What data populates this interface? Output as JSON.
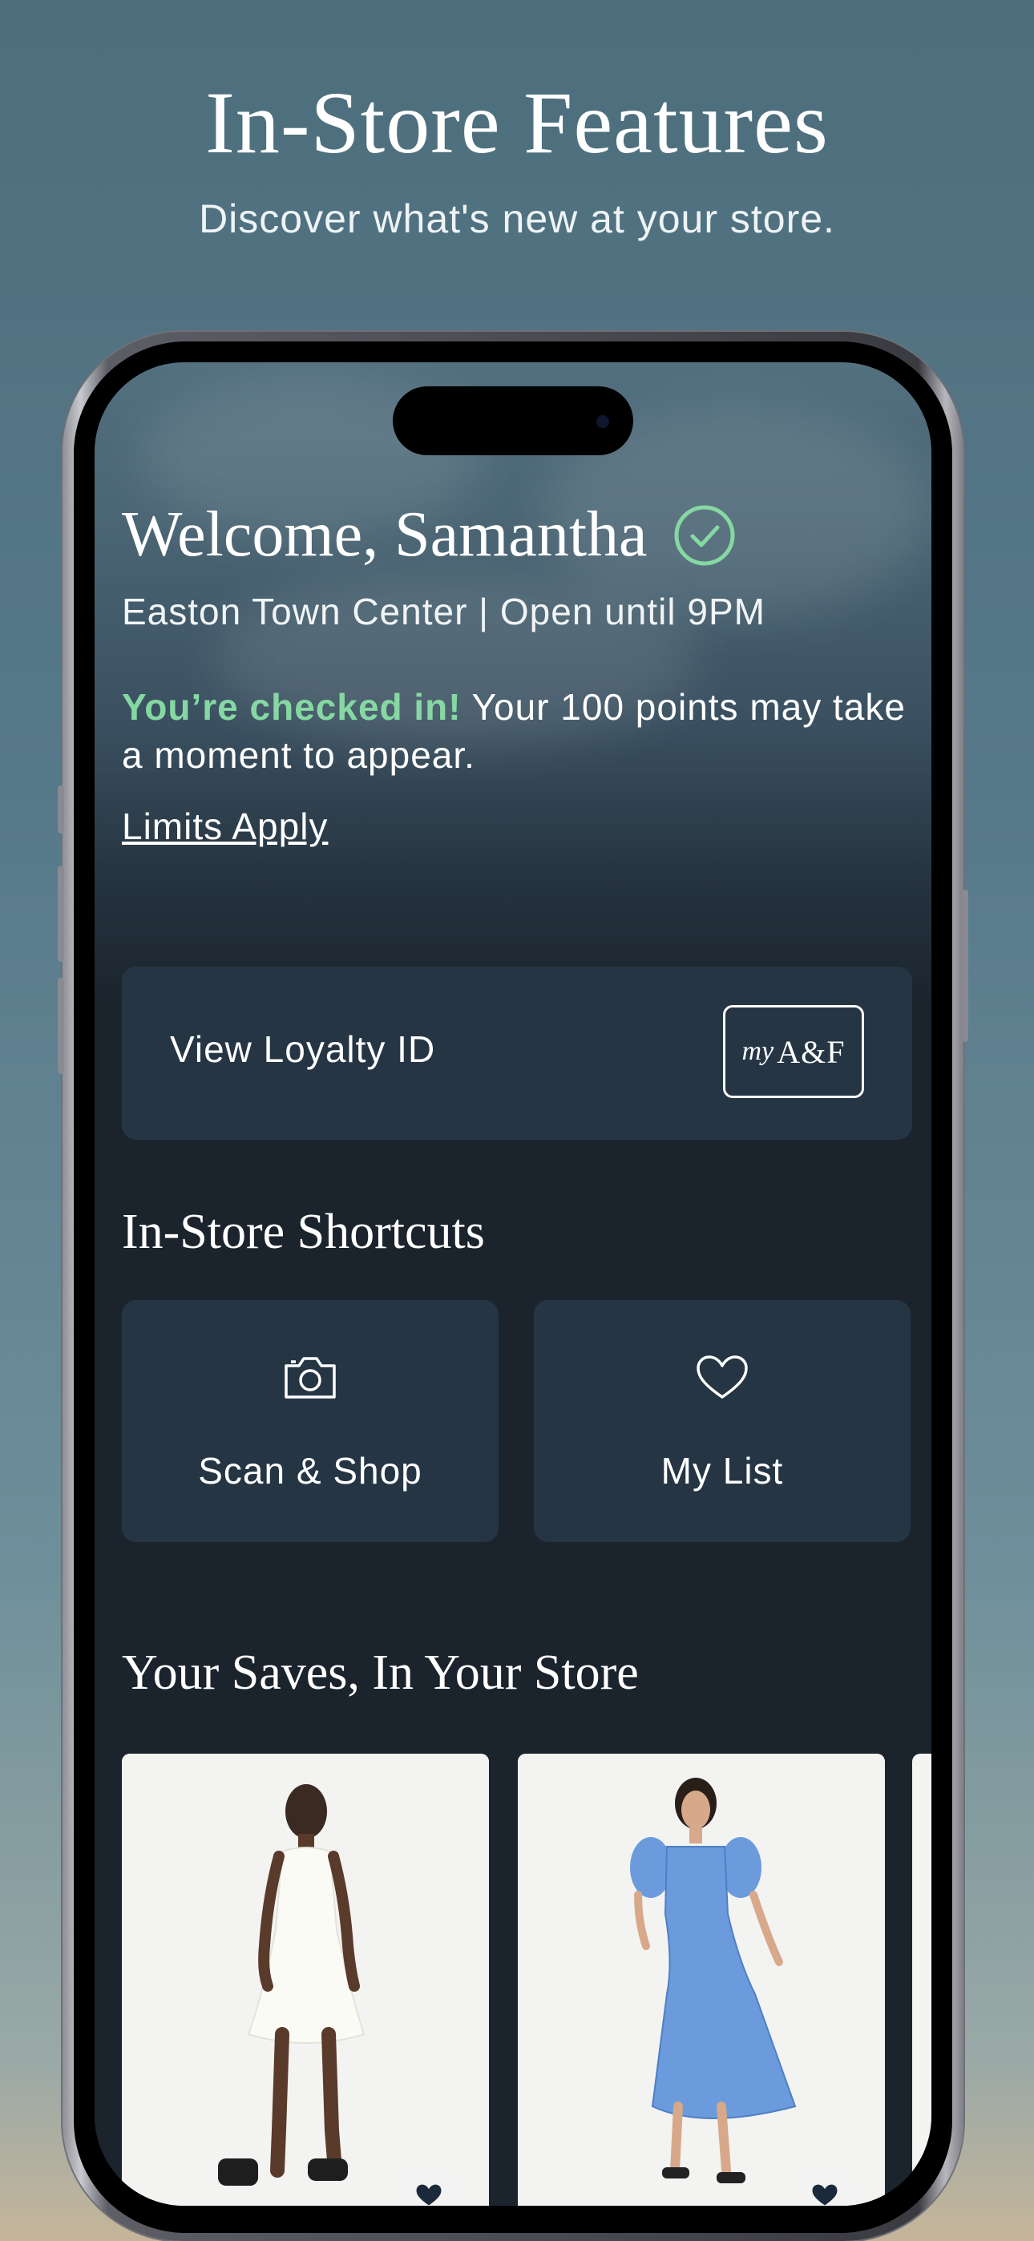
{
  "hero": {
    "title": "In-Store Features",
    "subtitle": "Discover what's new at your store."
  },
  "welcome": {
    "greeting": "Welcome, Samantha",
    "store_line": "Easton Town Center | Open until 9PM",
    "checked_in_bold": "You’re checked in!",
    "checked_in_rest": " Your 100 points may take a moment to appear.",
    "limits_link": "Limits Apply"
  },
  "loyalty": {
    "label": "View Loyalty ID",
    "logo_my": "my",
    "logo_af": "A&F"
  },
  "shortcuts": {
    "title": "In-Store Shortcuts",
    "items": [
      {
        "label": "Scan & Shop",
        "icon": "camera-icon"
      },
      {
        "label": "My List",
        "icon": "heart-outline-icon"
      }
    ]
  },
  "saves": {
    "title": "Your Saves, In Your Store",
    "products": [
      {
        "image": "white-tiered-dress-photo",
        "favorite": true
      },
      {
        "image": "blue-puff-sleeve-midi-dress-photo",
        "favorite": true
      }
    ]
  },
  "colors": {
    "checked_in_green": "#86d8a3",
    "card_bg": "#253544",
    "screen_bg": "#1b242d"
  }
}
